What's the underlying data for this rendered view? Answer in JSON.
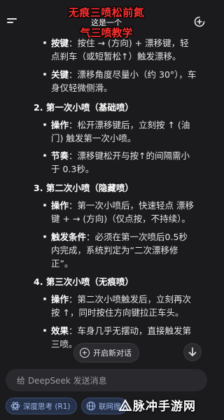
{
  "header": {
    "overlay_title": "无痕三喷松前氮",
    "overlay_sub": "这是一个",
    "overlay_title2": "气三喷教学"
  },
  "content": {
    "b1": {
      "label": "按键",
      "text_a": "：按住 → (方向) + 漂移键，轻",
      "text_b": "点刹车（或短暂松↑）触发漂移。"
    },
    "b2": {
      "label": "关键",
      "text_a": "：漂移角度尽量小（约 30°），车",
      "text_b": "身仅轻微侧滑。"
    },
    "s2": {
      "num": "2.",
      "title": "第一次小喷（基础喷）"
    },
    "b3": {
      "label": "操作",
      "text_a": "：松开漂移键后，立刻按 ↑ (油",
      "text_b": "门) 触发第一次小喷。"
    },
    "b4": {
      "label": "节奏",
      "text_a": "：漂移键松开与按↑的间隔需小",
      "text_b": "于 0.3秒。"
    },
    "s3": {
      "num": "3.",
      "title": "第二次小喷（隐藏喷）"
    },
    "b5": {
      "label": "操作",
      "text_a": "：第一次小喷后，快速轻点 漂移",
      "text_b": "键 + → (方向)（仅点按，不持续）。"
    },
    "b6": {
      "label": "触发条件",
      "text_a": "：必须在第一次喷后0.5秒",
      "text_b": "内完成，系统判定为“二次漂移修",
      "text_c": "正”。"
    },
    "s4": {
      "num": "4.",
      "title": "第三次小喷（无痕喷）"
    },
    "b7": {
      "label": "操作",
      "text_a": "：第二次小喷触发后，立刻再次",
      "text_b": "按 ↑，同时按住方向键拉正车头。"
    },
    "b8": {
      "label": "效果",
      "text_a": "：车身几乎无摆动，直接触发第",
      "text_b": "三喷。"
    }
  },
  "floating": {
    "new_dialog_label": "开启新对话"
  },
  "input": {
    "placeholder": "给 DeepSeek 发送消息"
  },
  "chips": {
    "deep_think": "深度思考 (R1)",
    "web_search": "联网搜"
  },
  "watermark": {
    "text": "脉冲手游网"
  }
}
